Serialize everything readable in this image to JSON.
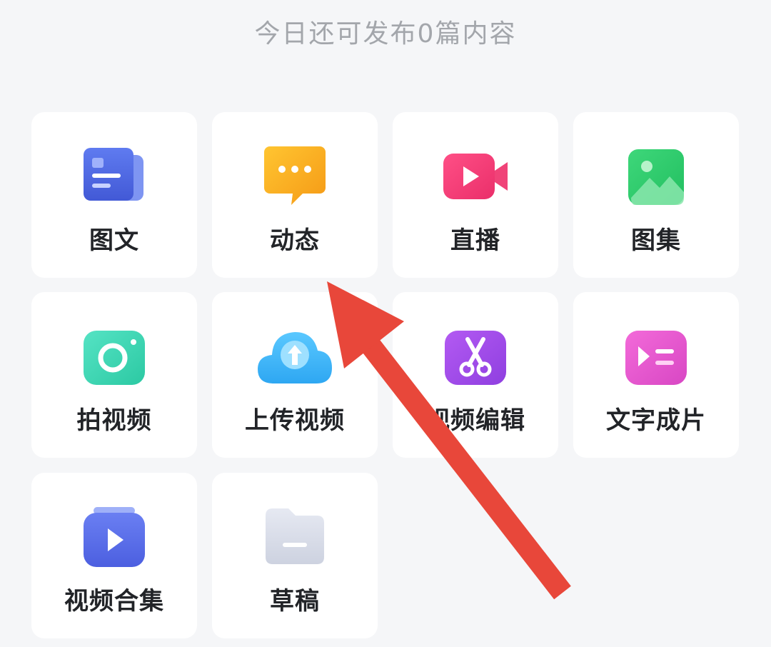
{
  "header": {
    "quota_text": "今日还可发布0篇内容"
  },
  "tiles": [
    {
      "label": "图文",
      "icon": "article-icon"
    },
    {
      "label": "动态",
      "icon": "chat-bubble-icon"
    },
    {
      "label": "直播",
      "icon": "live-camera-icon"
    },
    {
      "label": "图集",
      "icon": "gallery-icon"
    },
    {
      "label": "拍视频",
      "icon": "camera-icon"
    },
    {
      "label": "上传视频",
      "icon": "cloud-upload-icon"
    },
    {
      "label": "视频编辑",
      "icon": "scissors-icon"
    },
    {
      "label": "文字成片",
      "icon": "text-to-video-icon"
    },
    {
      "label": "视频合集",
      "icon": "video-collection-icon"
    },
    {
      "label": "草稿",
      "icon": "folder-icon"
    }
  ],
  "colors": {
    "background": "#f5f6f8",
    "tile": "#ffffff",
    "arrow": "#e8473a"
  }
}
